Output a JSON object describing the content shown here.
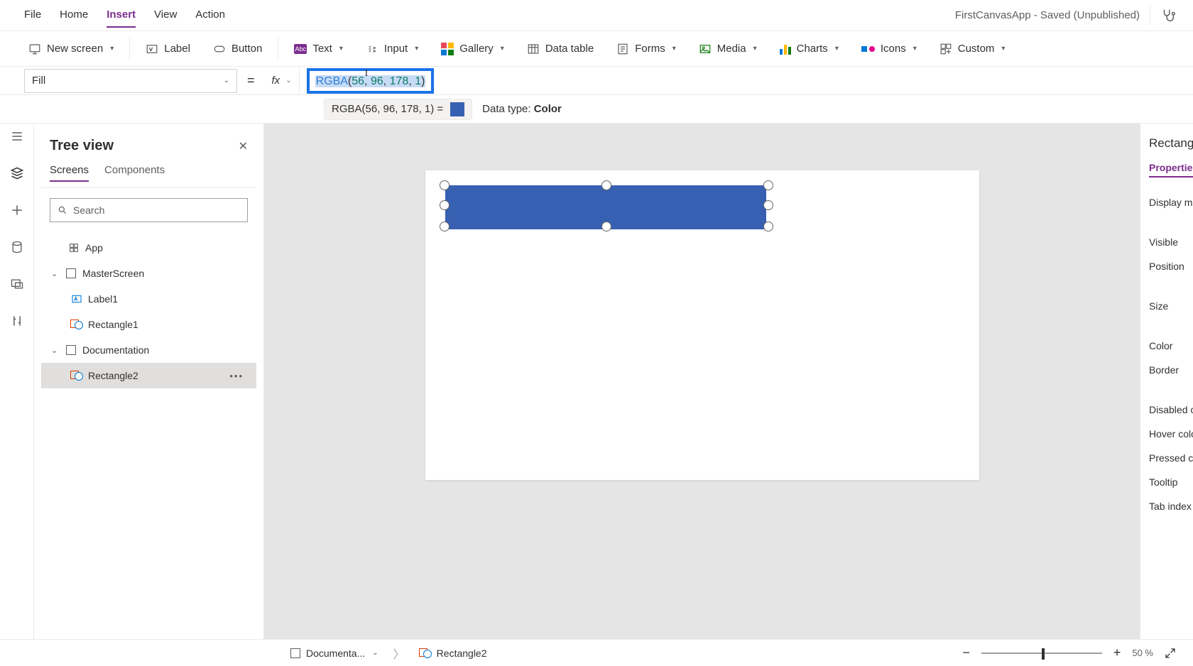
{
  "appTitle": "FirstCanvasApp - Saved (Unpublished)",
  "menu": {
    "file": "File",
    "home": "Home",
    "insert": "Insert",
    "view": "View",
    "action": "Action"
  },
  "ribbon": {
    "newScreen": "New screen",
    "label": "Label",
    "button": "Button",
    "text": "Text",
    "input": "Input",
    "gallery": "Gallery",
    "dataTable": "Data table",
    "forms": "Forms",
    "media": "Media",
    "charts": "Charts",
    "icons": "Icons",
    "custom": "Custom"
  },
  "property": {
    "selected": "Fill"
  },
  "formula": {
    "fn": "RGBA",
    "args": "(56, 96, 178, 1)",
    "resultText": "RGBA(56, 96, 178, 1)  =",
    "dataTypeLabel": "Data type: ",
    "dataTypeValue": "Color"
  },
  "tree": {
    "title": "Tree view",
    "tabs": {
      "screens": "Screens",
      "components": "Components"
    },
    "searchPlaceholder": "Search",
    "app": "App",
    "nodes": {
      "master": "MasterScreen",
      "label1": "Label1",
      "rect1": "Rectangle1",
      "doc": "Documentation",
      "rect2": "Rectangle2"
    }
  },
  "props": {
    "heading": "Rectangle",
    "tab": "Properties",
    "rows": {
      "displayMode": "Display mode",
      "visible": "Visible",
      "position": "Position",
      "size": "Size",
      "color": "Color",
      "border": "Border",
      "disabledColor": "Disabled color",
      "hoverColor": "Hover color",
      "pressedColor": "Pressed color",
      "tooltip": "Tooltip",
      "tabIndex": "Tab index"
    }
  },
  "status": {
    "crumb1": "Documenta...",
    "crumb2": "Rectangle2",
    "zoomPct": "50  %"
  }
}
